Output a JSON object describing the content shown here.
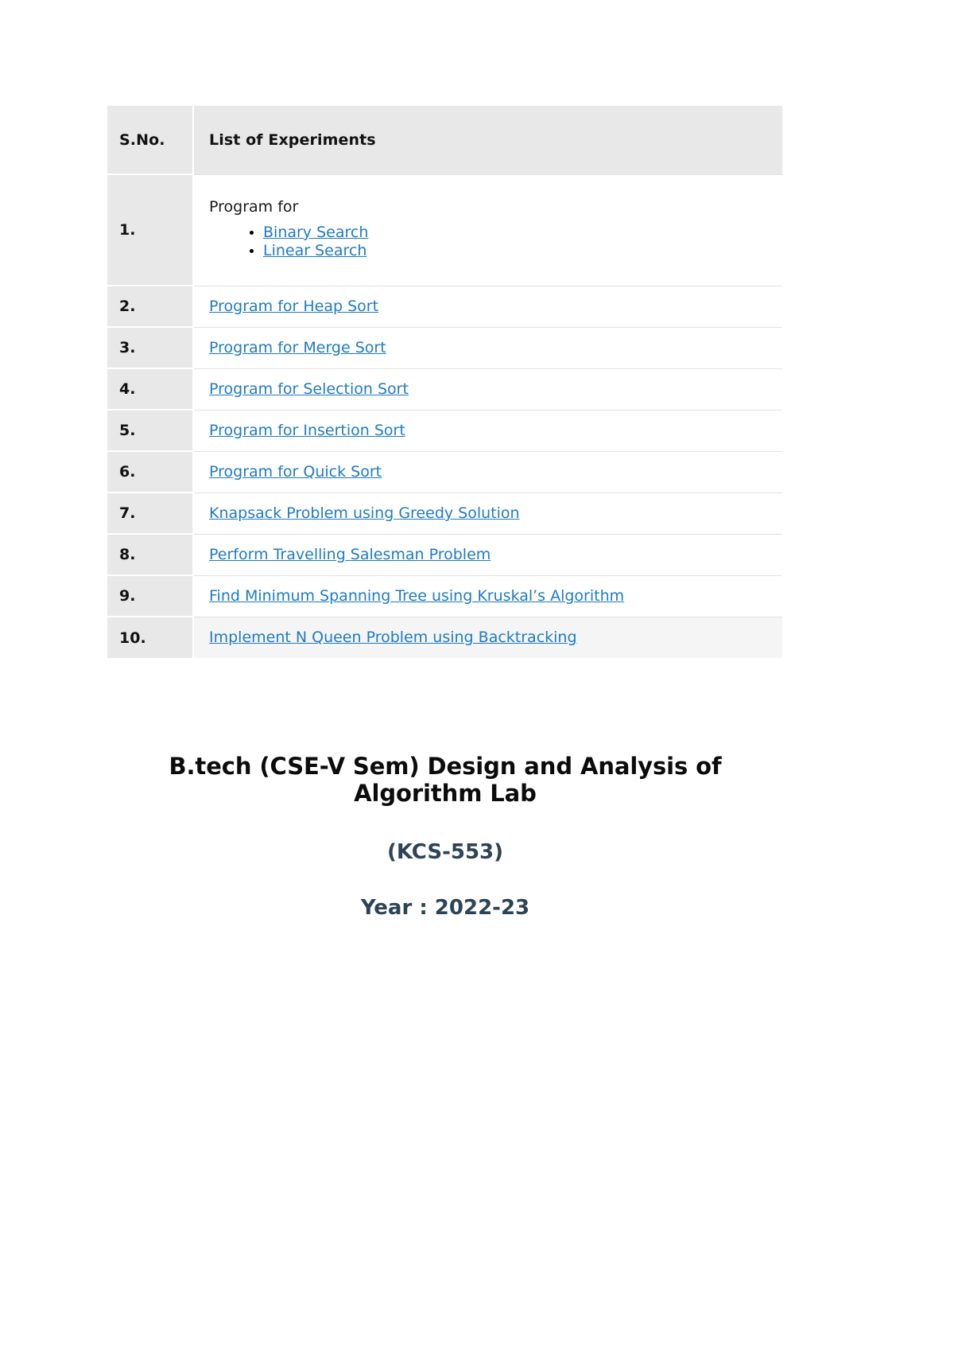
{
  "table": {
    "columns": [
      "S.No.",
      "List of Experiments"
    ],
    "rows": [
      {
        "sno": "1.",
        "lead_text": "Program for",
        "bullets": [
          "Binary Search",
          "Linear Search"
        ]
      },
      {
        "sno": "2.",
        "link": "Program for Heap Sort"
      },
      {
        "sno": "3.",
        "link": "Program for Merge Sort"
      },
      {
        "sno": "4.",
        "link": "Program for Selection Sort"
      },
      {
        "sno": "5.",
        "link": "Program for Insertion Sort"
      },
      {
        "sno": "6.",
        "link": "Program for Quick Sort"
      },
      {
        "sno": "7.",
        "link": "Knapsack Problem using Greedy Solution"
      },
      {
        "sno": "8.",
        "link": "Perform Travelling Salesman Problem"
      },
      {
        "sno": "9.",
        "link": "Find Minimum Spanning Tree using Kruskal’s Algorithm"
      },
      {
        "sno": "10.",
        "link": "Implement N Queen Problem using Backtracking"
      }
    ]
  },
  "headings": {
    "title": "B.tech (CSE-V Sem) Design and Analysis of Algorithm Lab",
    "code": "(KCS-553)",
    "year": "Year : 2022-23"
  },
  "colors": {
    "link": "#1f7bc4",
    "heading_accent": "#2d4356",
    "header_row_bg": "#e8e8e8",
    "alt_row_bg": "#f5f5f5"
  }
}
